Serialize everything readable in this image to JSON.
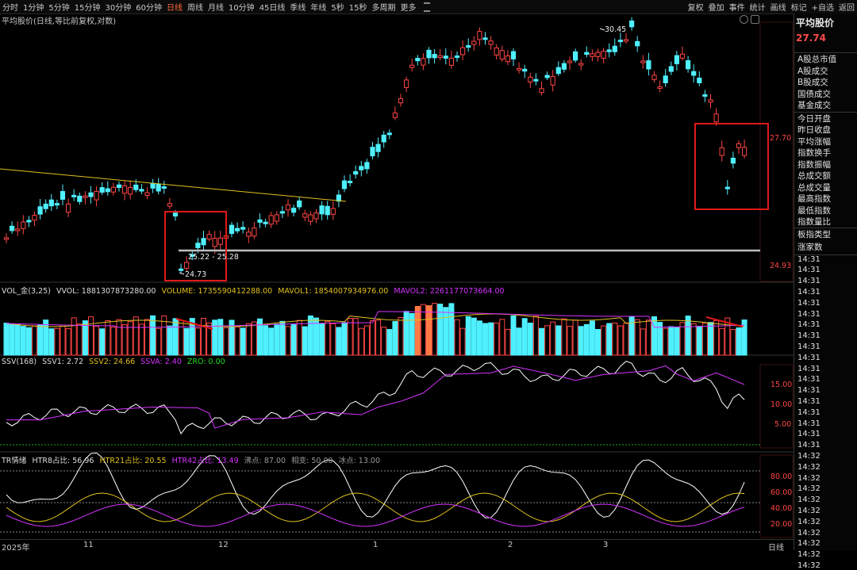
{
  "toolbar": {
    "periods": [
      "分时",
      "1分钟",
      "5分钟",
      "15分钟",
      "30分钟",
      "60分钟",
      "日线",
      "周线",
      "月线",
      "10分钟",
      "45日线",
      "季线",
      "年线",
      "5秒",
      "15秒",
      "多周期",
      "更多"
    ],
    "active_period": "日线",
    "actions": [
      "复权",
      "叠加",
      "事件",
      "统计",
      "画线",
      "标记",
      "+自选",
      "返回"
    ]
  },
  "main_legend": "平均股价(日线,等比前复权,对数)",
  "sidebar": {
    "title": "平均股价",
    "price": "27.74",
    "group1": [
      "A股总市值",
      "A股成交",
      "B股成交",
      "国债成交",
      "基金成交"
    ],
    "group2": [
      "今日开盘",
      "昨日收盘",
      "平均涨幅",
      "指数换手",
      "指数振幅",
      "总成交额",
      "总成交量",
      "最高指数",
      "最低指数",
      "指数量比"
    ],
    "group3": [
      "板指类型",
      "涨家数"
    ],
    "times": [
      "14:31",
      "14:31",
      "14:31",
      "14:31",
      "14:31",
      "14:31",
      "14:31",
      "14:31",
      "14:31",
      "14:31",
      "14:31",
      "14:31",
      "14:31",
      "14:31",
      "14:31",
      "14:31",
      "14:31",
      "14:31",
      "14:32",
      "14:32",
      "14:32",
      "14:32",
      "14:32",
      "14:32",
      "14:32",
      "14:32",
      "14:32",
      "14:32",
      "14:32"
    ]
  },
  "vol_legend": {
    "name": "VOL_金(3,25)",
    "vvol": "VVOL: 1881307873280.00",
    "volume": "VOLUME: 1735590412288.00",
    "mavol1": "MAVOL1: 1854007934976.00",
    "mavol2": "MAVOL2: 2261177073664.00"
  },
  "ssv_legend": {
    "name": "SSV(168)",
    "ssv1": "SSV1: 2.72",
    "ssv2": "SSV2: 24.66",
    "ssva": "SSVA: 2.40",
    "zro": "ZRO: 0.00"
  },
  "tr_legend": {
    "name": "TR情绪",
    "htr8": "HTR8占比: 56.96",
    "htr21": "HTR21占比: 20.55",
    "htr42": "HTR42占比: 13.49",
    "boil": "沸点: 87.00",
    "mid": "相变: 50.00",
    "ice": "冰点: 13.00"
  },
  "annotations": {
    "high": "30.45",
    "low": "24.73",
    "range": "25.22 - 25.28",
    "price_right_1": "27.70",
    "price_right_2": "24.93"
  },
  "ssv_axis": [
    "15.00",
    "10.00",
    "5.00"
  ],
  "tr_axis": [
    "80.00",
    "60.00",
    "40.00",
    "20.00"
  ],
  "x_axis": [
    "2025年",
    "11",
    "12",
    "1",
    "2",
    "3"
  ],
  "x_axis_right": "日线",
  "colors": {
    "up": "#ff4545",
    "down": "#4ff0ff",
    "yellow": "#e0c020",
    "magenta": "#d633ff",
    "white": "#ffffff",
    "box": "#e01818",
    "orange": "#ff7a45"
  },
  "chart_data": {
    "type": "candlestick",
    "title": "平均股价(日线,等比前复权,对数)",
    "labelled_prices": {
      "period_high": 30.45,
      "period_low": 24.73,
      "last": 27.74
    },
    "shown_range": "25.22 - 25.28",
    "x_axis_labels": [
      "2025年",
      "11",
      "12",
      "1",
      "2",
      "3"
    ],
    "indicators": {
      "VOL": {
        "VVOL": 1881307873280.0,
        "VOLUME": 1735590412288.0,
        "MAVOL1": 1854007934976.0,
        "MAVOL2": 2261177073664.0
      },
      "SSV": {
        "SSV1": 2.72,
        "SSV2": 24.66,
        "SSVA": 2.4,
        "ZRO": 0.0,
        "ticks": [
          15,
          10,
          5
        ]
      },
      "TR": {
        "HTR8": 56.96,
        "HTR21": 20.55,
        "HTR42": 13.49,
        "boil": 87.0,
        "mid": 50.0,
        "ice": 13.0,
        "ticks": [
          80,
          60,
          40,
          20
        ]
      }
    }
  }
}
